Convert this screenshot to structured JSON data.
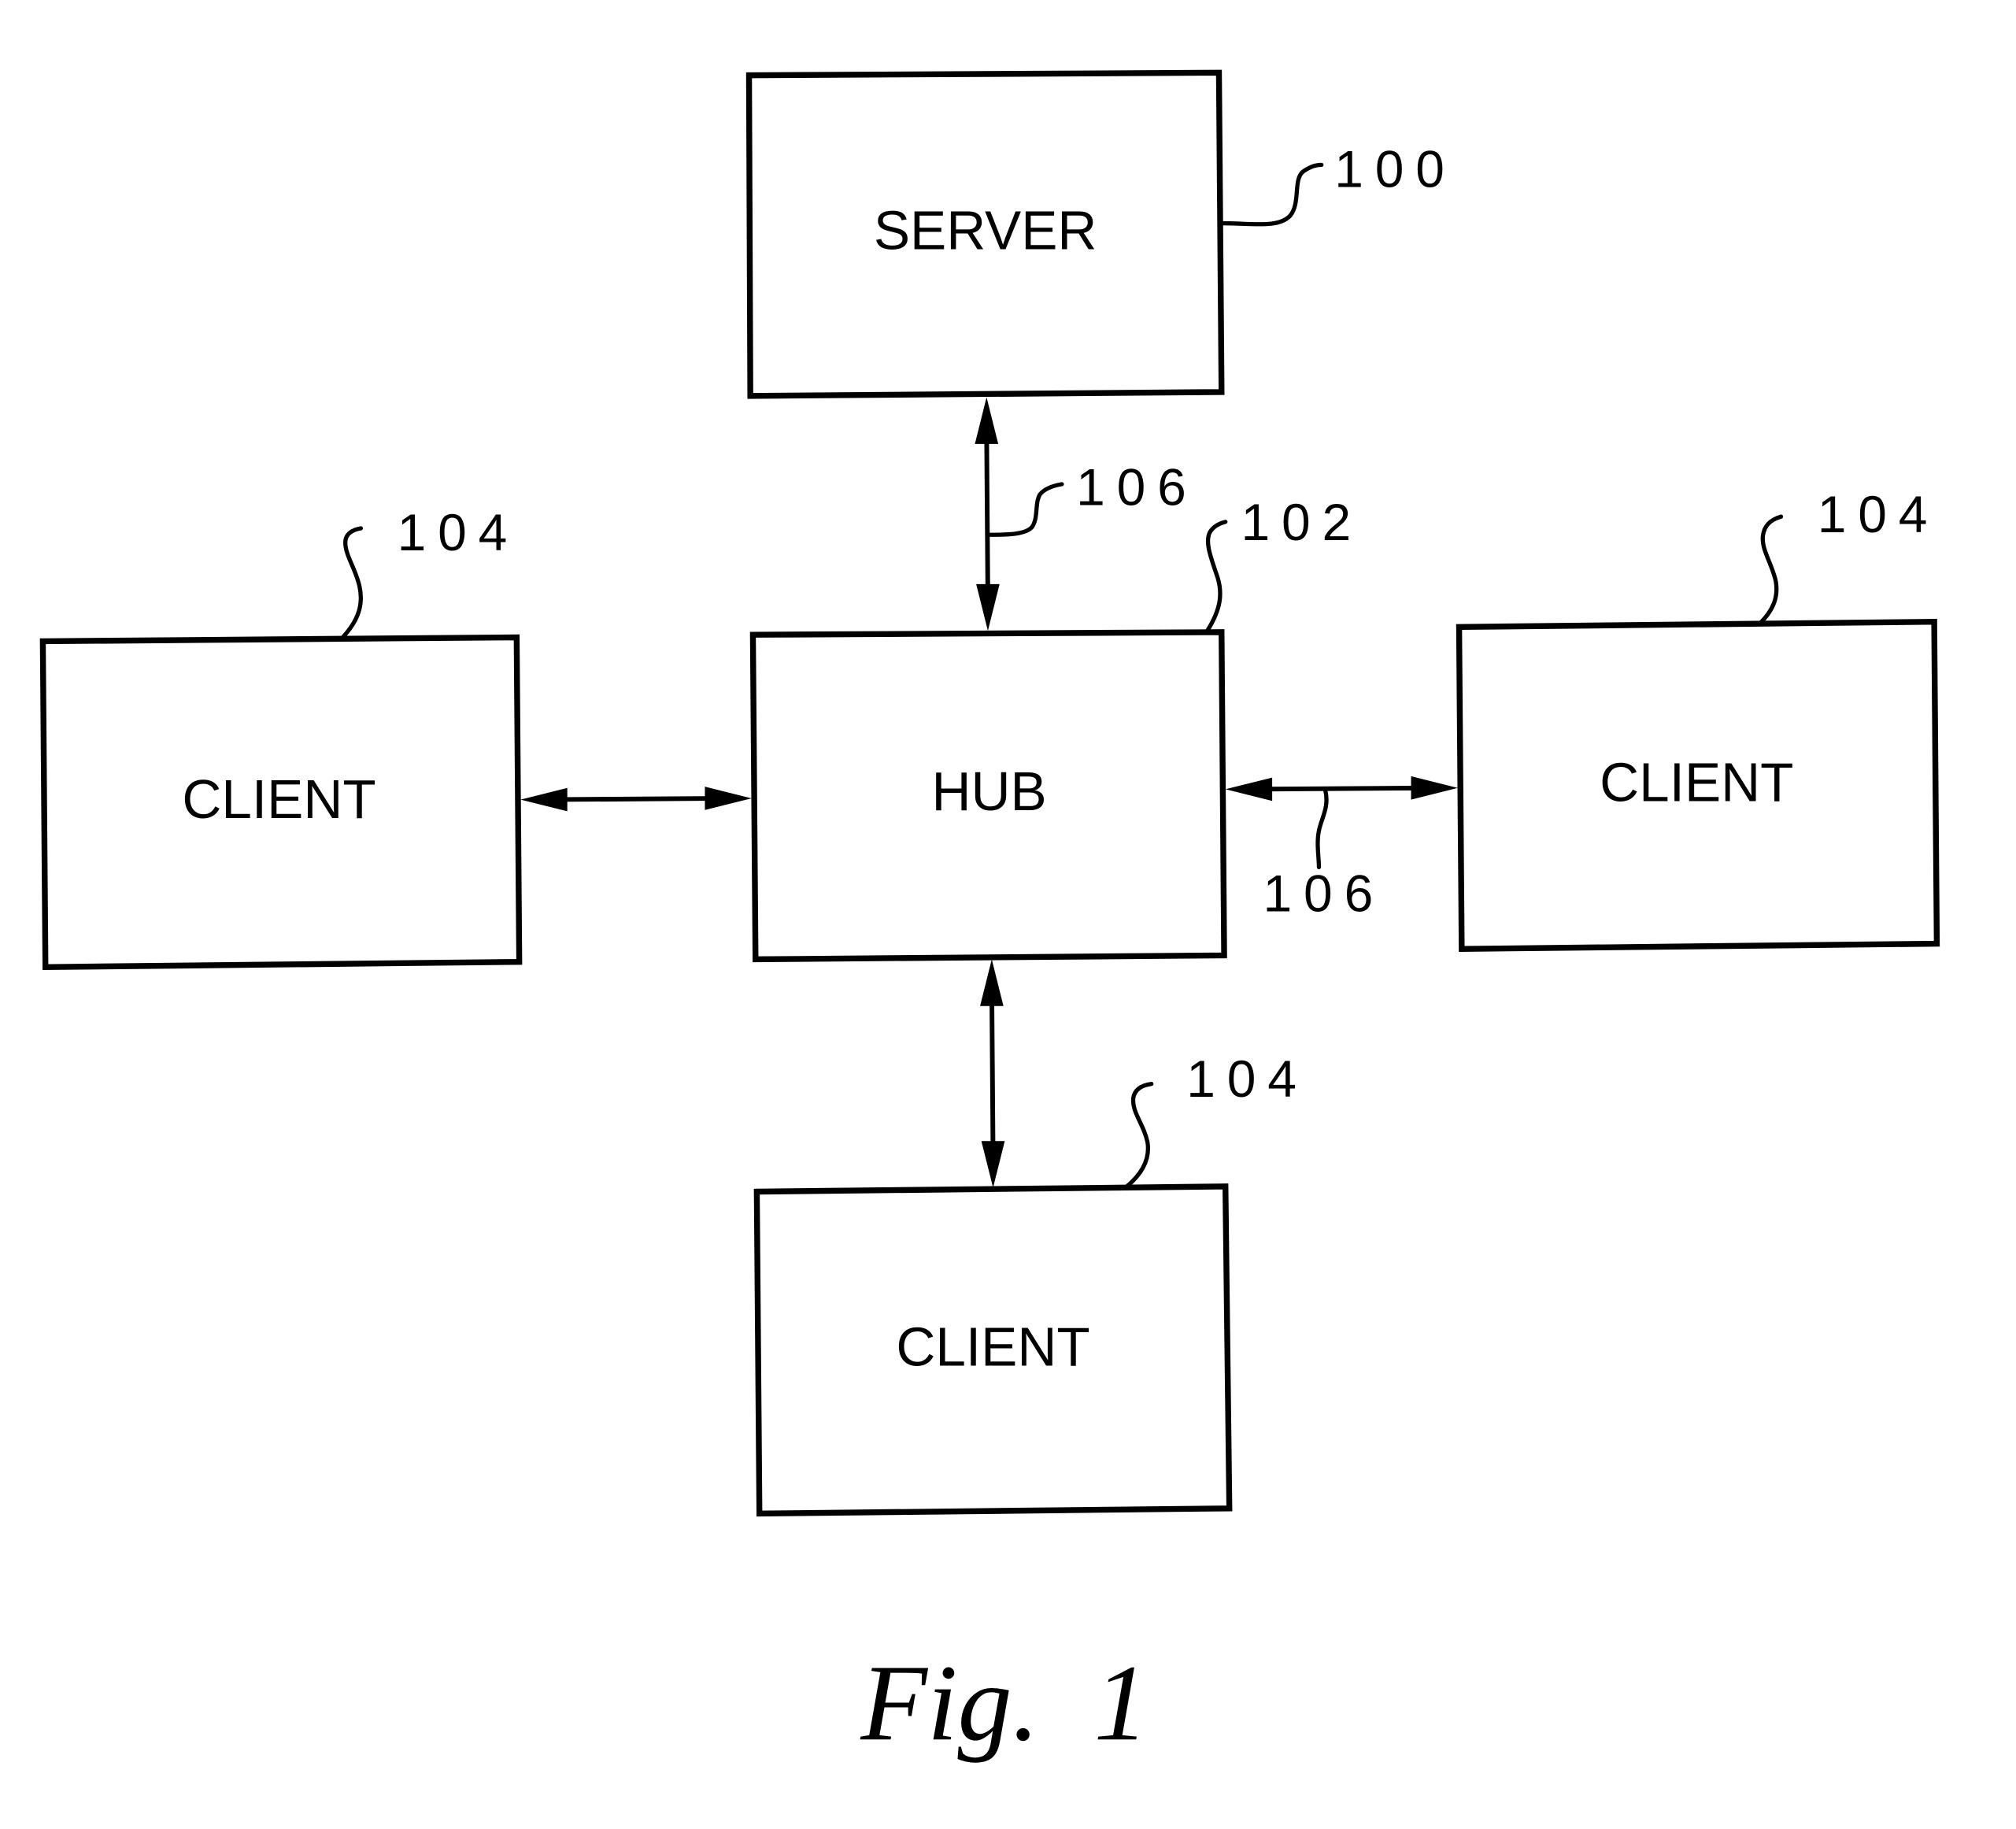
{
  "figure": {
    "caption": "Fig.  1",
    "nodes": {
      "server": {
        "label": "SERVER",
        "ref": "100"
      },
      "hub": {
        "label": "HUB",
        "ref": "102"
      },
      "client_left": {
        "label": "CLIENT",
        "ref": "104"
      },
      "client_right": {
        "label": "CLIENT",
        "ref": "104"
      },
      "client_bottom": {
        "label": "CLIENT",
        "ref": "104"
      }
    },
    "connections": [
      {
        "from": "server",
        "to": "hub",
        "type": "bidirectional",
        "ref": "106"
      },
      {
        "from": "client_left",
        "to": "hub",
        "type": "bidirectional",
        "ref": ""
      },
      {
        "from": "hub",
        "to": "client_right",
        "type": "bidirectional",
        "ref": "106"
      },
      {
        "from": "hub",
        "to": "client_bottom",
        "type": "bidirectional",
        "ref": ""
      }
    ]
  }
}
